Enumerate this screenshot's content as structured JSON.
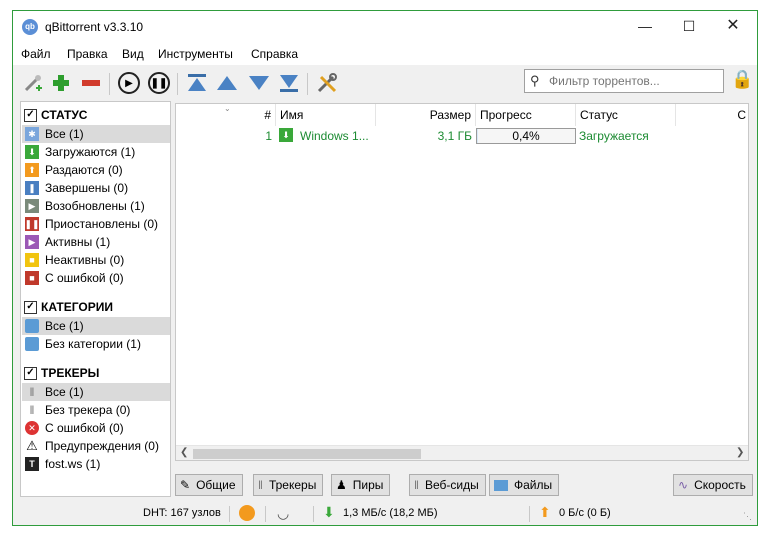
{
  "window": {
    "title": "qBittorrent v3.3.10",
    "app_icon_text": "qb"
  },
  "menu": [
    "Файл",
    "Правка",
    "Вид",
    "Инструменты",
    "Справка"
  ],
  "search": {
    "placeholder": "Фильтр торрентов..."
  },
  "sidebar": {
    "status": {
      "header": "СТАТУС",
      "items": [
        {
          "label": "Все (1)",
          "icon": "all-icon",
          "color": "#7aa6dc"
        },
        {
          "label": "Загружаются (1)",
          "icon": "downloading-icon",
          "color": "#3aa83a"
        },
        {
          "label": "Раздаются (0)",
          "icon": "seeding-icon",
          "color": "#f39a1e"
        },
        {
          "label": "Завершены (0)",
          "icon": "completed-icon",
          "color": "#4a7fc1"
        },
        {
          "label": "Возобновлены (1)",
          "icon": "resumed-icon",
          "color": "#7a8a7a"
        },
        {
          "label": "Приостановлены (0)",
          "icon": "paused-icon",
          "color": "#c0392b"
        },
        {
          "label": "Активны (1)",
          "icon": "active-icon",
          "color": "#9b59b6"
        },
        {
          "label": "Неактивны (0)",
          "icon": "inactive-icon",
          "color": "#f1c40f"
        },
        {
          "label": "С ошибкой (0)",
          "icon": "error-icon",
          "color": "#c0392b"
        }
      ]
    },
    "categories": {
      "header": "КАТЕГОРИИ",
      "items": [
        {
          "label": "Все (1)",
          "icon": "folder-icon"
        },
        {
          "label": "Без категории (1)",
          "icon": "folder-icon"
        }
      ]
    },
    "trackers": {
      "header": "ТРЕКЕРЫ",
      "items": [
        {
          "label": "Все (1)",
          "icon": "tracker-icon"
        },
        {
          "label": "Без трекера (0)",
          "icon": "tracker-icon"
        },
        {
          "label": "С ошибкой (0)",
          "icon": "error-circle-icon"
        },
        {
          "label": "Предупреждения (0)",
          "icon": "warning-icon"
        },
        {
          "label": "fost.ws (1)",
          "icon": "site-favicon-icon"
        }
      ]
    }
  },
  "table": {
    "columns": [
      "#",
      "Имя",
      "Размер",
      "Прогресс",
      "Статус",
      "С"
    ],
    "rows": [
      {
        "num": "1",
        "name": "Windows 1...",
        "size": "3,1 ГБ",
        "progress_text": "0,4%",
        "progress": 0.004,
        "status": "Загружается"
      }
    ]
  },
  "tabs": [
    "Общие",
    "Трекеры",
    "Пиры",
    "Веб-сиды",
    "Файлы",
    "Скорость"
  ],
  "statusbar": {
    "dht": "DHT: 167 узлов",
    "download": "1,3 МБ/с (18,2 МБ)",
    "upload": "0 Б/с (0 Б)"
  },
  "colors": {
    "downloading_green": "#1c8b32",
    "selection": "#dadada",
    "window_border": "#2f9c3c"
  }
}
